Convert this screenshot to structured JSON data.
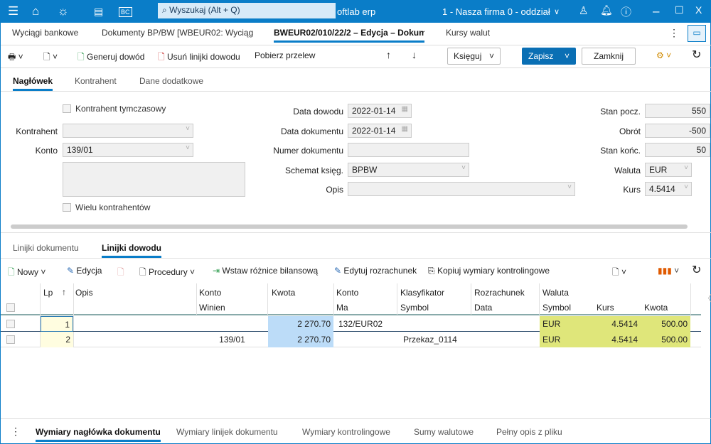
{
  "titlebar": {
    "search_placeholder": "Wyszukaj (Alt + Q)",
    "app_name": "oftlab erp",
    "company": "1 - Nasza firma 0 - oddział",
    "bc_label": "BC"
  },
  "tabs": [
    {
      "label": "Wyciągi bankowe"
    },
    {
      "label": "Dokumenty BP/BW [WBEUR02: Wyciąg"
    },
    {
      "label": "BWEUR02/010/22/2 – Edycja – Dokum"
    },
    {
      "label": "Kursy walut"
    }
  ],
  "toolbar": {
    "generate": "Generuj dowód",
    "remove": "Usuń linijki dowodu",
    "fetch": "Pobierz przelew",
    "post": "Księguj",
    "save": "Zapisz",
    "close": "Zamknij"
  },
  "sections": [
    {
      "label": "Nagłówek"
    },
    {
      "label": "Kontrahent"
    },
    {
      "label": "Dane dodatkowe"
    }
  ],
  "form": {
    "temp_contractor": "Kontrahent tymczasowy",
    "contractor_label": "Kontrahent",
    "contractor": "",
    "account_label": "Konto",
    "account": "139/01",
    "multi_contractors": "Wielu kontrahentów",
    "proof_date_label": "Data dowodu",
    "proof_date": "2022-01-14",
    "doc_date_label": "Data dokumentu",
    "doc_date": "2022-01-14",
    "doc_number_label": "Numer dokumentu",
    "doc_number": "",
    "scheme_label": "Schemat księg.",
    "scheme": "BPBW",
    "desc_label": "Opis",
    "desc": "",
    "start_label": "Stan pocz.",
    "start": "550",
    "turnover_label": "Obrót",
    "turnover": "-500",
    "end_label": "Stan końc.",
    "end": "50",
    "currency_label": "Waluta",
    "currency": "EUR",
    "rate_label": "Kurs",
    "rate": "4.5414"
  },
  "lower_tabs": [
    {
      "label": "Linijki dokumentu"
    },
    {
      "label": "Linijki dowodu"
    }
  ],
  "grid_toolbar": {
    "new": "Nowy",
    "edit": "Edycja",
    "procedures": "Procedury",
    "insert_diff": "Wstaw różnice bilansową",
    "edit_settlement": "Edytuj rozrachunek",
    "copy_dims": "Kopiuj wymiary kontrolingowe"
  },
  "grid": {
    "headers": {
      "lp": "Lp",
      "opis": "Opis",
      "konto": "Konto",
      "winien": "Winien",
      "kwota": "Kwota",
      "konto_ma": "Konto",
      "ma": "Ma",
      "klasyfikator": "Klasyfikator",
      "symbol": "Symbol",
      "rozrachunek": "Rozrachunek",
      "data": "Data",
      "waluta": "Waluta",
      "w_symbol": "Symbol",
      "w_kurs": "Kurs",
      "w_kwota": "Kwota"
    },
    "rows": [
      {
        "lp": "1",
        "opis": "",
        "winien": "",
        "kwota": "2 270.70",
        "ma": "132/EUR02",
        "symbol": "",
        "data": "",
        "w_symbol": "EUR",
        "w_kurs": "4.5414",
        "w_kwota": "500.00"
      },
      {
        "lp": "2",
        "opis": "",
        "winien": "139/01",
        "kwota": "2 270.70",
        "ma": "",
        "symbol": "Przekaz_0114",
        "data": "",
        "w_symbol": "EUR",
        "w_kurs": "4.5414",
        "w_kwota": "500.00"
      }
    ]
  },
  "bottom_tabs": [
    {
      "label": "Wymiary nagłówka dokumentu"
    },
    {
      "label": "Wymiary linijek dokumentu"
    },
    {
      "label": "Wymiary kontrolingowe"
    },
    {
      "label": "Sumy walutowe"
    },
    {
      "label": "Pełny opis z pliku"
    }
  ],
  "colors": {
    "accent": "#0a7dc8",
    "amount_bg": "#bcdcf8",
    "currency_bg": "#dfe67a",
    "lp_bg": "#fffde0"
  }
}
